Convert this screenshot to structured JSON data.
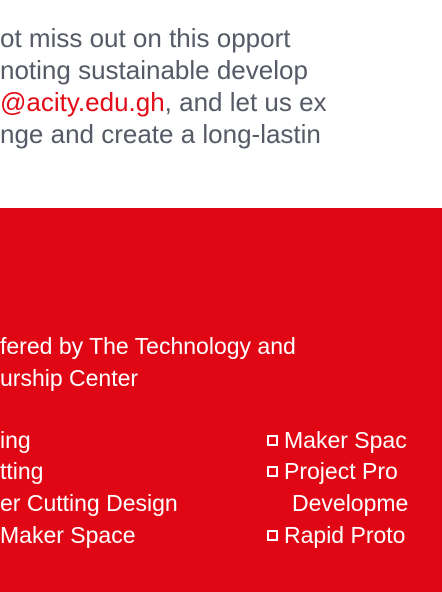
{
  "paragraph": {
    "line1": "ot miss out on this opport",
    "line2": "noting sustainable develop",
    "line3_link": "@acity.edu.gh",
    "line3_rest": ", and let us ex",
    "line4": "nge and create a long-lastin"
  },
  "services": {
    "intro_line1": "fered by The Technology and",
    "intro_line2": "urship Center",
    "left_items": [
      "ing",
      "tting",
      "er Cutting Design",
      "Maker Space"
    ],
    "right_items": [
      "Maker Spac",
      "Project Pro",
      "Developme",
      "Rapid Proto"
    ]
  },
  "colors": {
    "band": "#e10613",
    "text": "#555a66",
    "link": "#e30b17"
  }
}
